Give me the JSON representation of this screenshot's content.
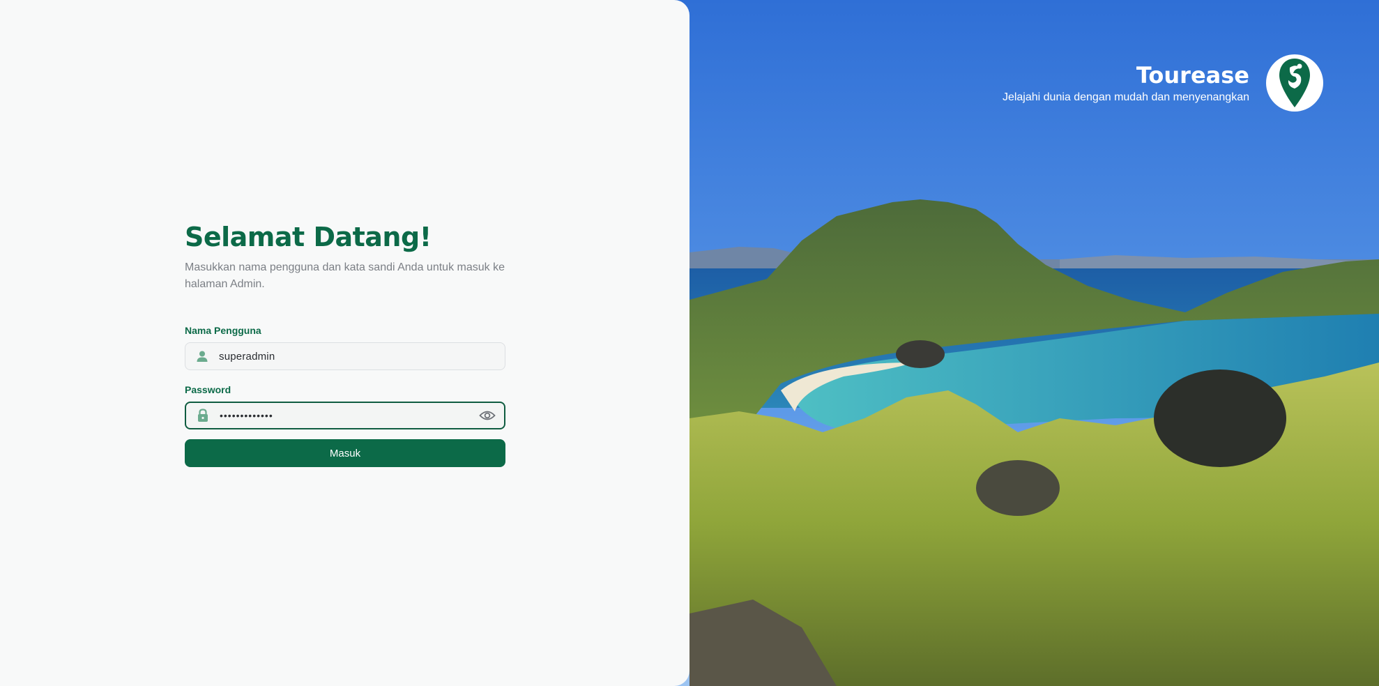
{
  "login": {
    "title": "Selamat Datang!",
    "subtitle": "Masukkan nama pengguna dan kata sandi Anda untuk masuk ke halaman Admin.",
    "username_label": "Nama Pengguna",
    "username_value": "superadmin",
    "password_label": "Password",
    "password_value": "•••••••••••••",
    "submit_label": "Masuk"
  },
  "brand": {
    "name": "Tourease",
    "tagline": "Jelajahi dunia dengan mudah dan menyenangkan",
    "logo_icon": "tourease-logo-icon"
  },
  "icons": {
    "username": "user-icon",
    "password": "lock-icon",
    "toggle_visibility": "eye-icon"
  },
  "colors": {
    "primary": "#0c6a48",
    "panel_bg": "#f8f9f9",
    "subtitle": "#7b7f85"
  }
}
